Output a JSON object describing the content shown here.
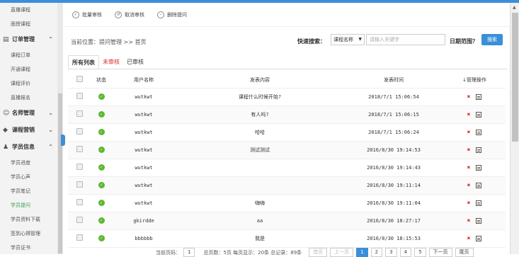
{
  "sidebar": {
    "top_items": [
      "直播课程",
      "面授课程"
    ],
    "groups": [
      {
        "icon": "clipboard-icon",
        "label": "订单管理",
        "chevron": "up",
        "items": [
          "课程订单",
          "开通课程",
          "课程评价",
          "直播报名"
        ]
      },
      {
        "icon": "users-icon",
        "label": "名师管理",
        "chevron": "down",
        "items": []
      },
      {
        "icon": "tag-icon",
        "label": "课程营销",
        "chevron": "down",
        "items": []
      },
      {
        "icon": "user-icon",
        "label": "学员信息",
        "chevron": "up",
        "items": [
          "学员进度",
          "学员心声",
          "学员笔记",
          "学员提问",
          "学员资料下载",
          "签到心得管理",
          "学员证书"
        ]
      }
    ],
    "active_item": "学员提问"
  },
  "toolbar": {
    "batch_approve": "批量审核",
    "cancel_approve": "取消审核",
    "delete_question": "删除提问"
  },
  "breadcrumb": "当前位置：提问管理 >> 首页",
  "quick_search": {
    "label": "快速搜索：",
    "select_value": "课程名称",
    "placeholder": "请输入关键字",
    "date_label": "日期范围？",
    "search_button": "搜索"
  },
  "tabs": [
    {
      "label": "所有列表",
      "active": true,
      "color": "#333333"
    },
    {
      "label": "未审核",
      "active": false,
      "color": "#d9302c"
    },
    {
      "label": "已审核",
      "active": false,
      "color": "#333333"
    }
  ],
  "table": {
    "headers": [
      "",
      "状态",
      "用户名称",
      "发表内容",
      "发表时间",
      "管理操作"
    ],
    "rows": [
      {
        "user": "wutkwt",
        "content": "课程什么时候开始?",
        "time": "2018/7/1 15:06:54"
      },
      {
        "user": "wutkwt",
        "content": "有人吗?",
        "time": "2018/7/1 15:06:15"
      },
      {
        "user": "wutkwt",
        "content": "哈哈",
        "time": "2018/7/1 15:06:24"
      },
      {
        "user": "wutkwt",
        "content": "测试测试",
        "time": "2016/8/30 19:14:53"
      },
      {
        "user": "wutkwt",
        "content": "",
        "time": "2016/8/30 19:14:43"
      },
      {
        "user": "wutkwt",
        "content": "",
        "time": "2016/8/30 19:11:14"
      },
      {
        "user": "wutkwt",
        "content": "嗨嗨",
        "time": "2016/8/30 19:11:04"
      },
      {
        "user": "gkirdde",
        "content": "aa",
        "time": "2016/8/30 18:27:17"
      },
      {
        "user": "bbbbbb",
        "content": "我是",
        "time": "2016/8/30 18:15:53"
      }
    ]
  },
  "pager": {
    "current_label": "当前页码：",
    "current_page": "1",
    "summary": "总页数：5页 每页显示：20条 总记录：89条",
    "first": "首页",
    "prev": "上一页",
    "pages": [
      "1",
      "2",
      "3",
      "4",
      "5"
    ],
    "next": "下一页",
    "last": "尾页"
  },
  "colors": {
    "accent": "#3a8fd8",
    "danger": "#d9302c",
    "ok": "#5cb82e"
  }
}
